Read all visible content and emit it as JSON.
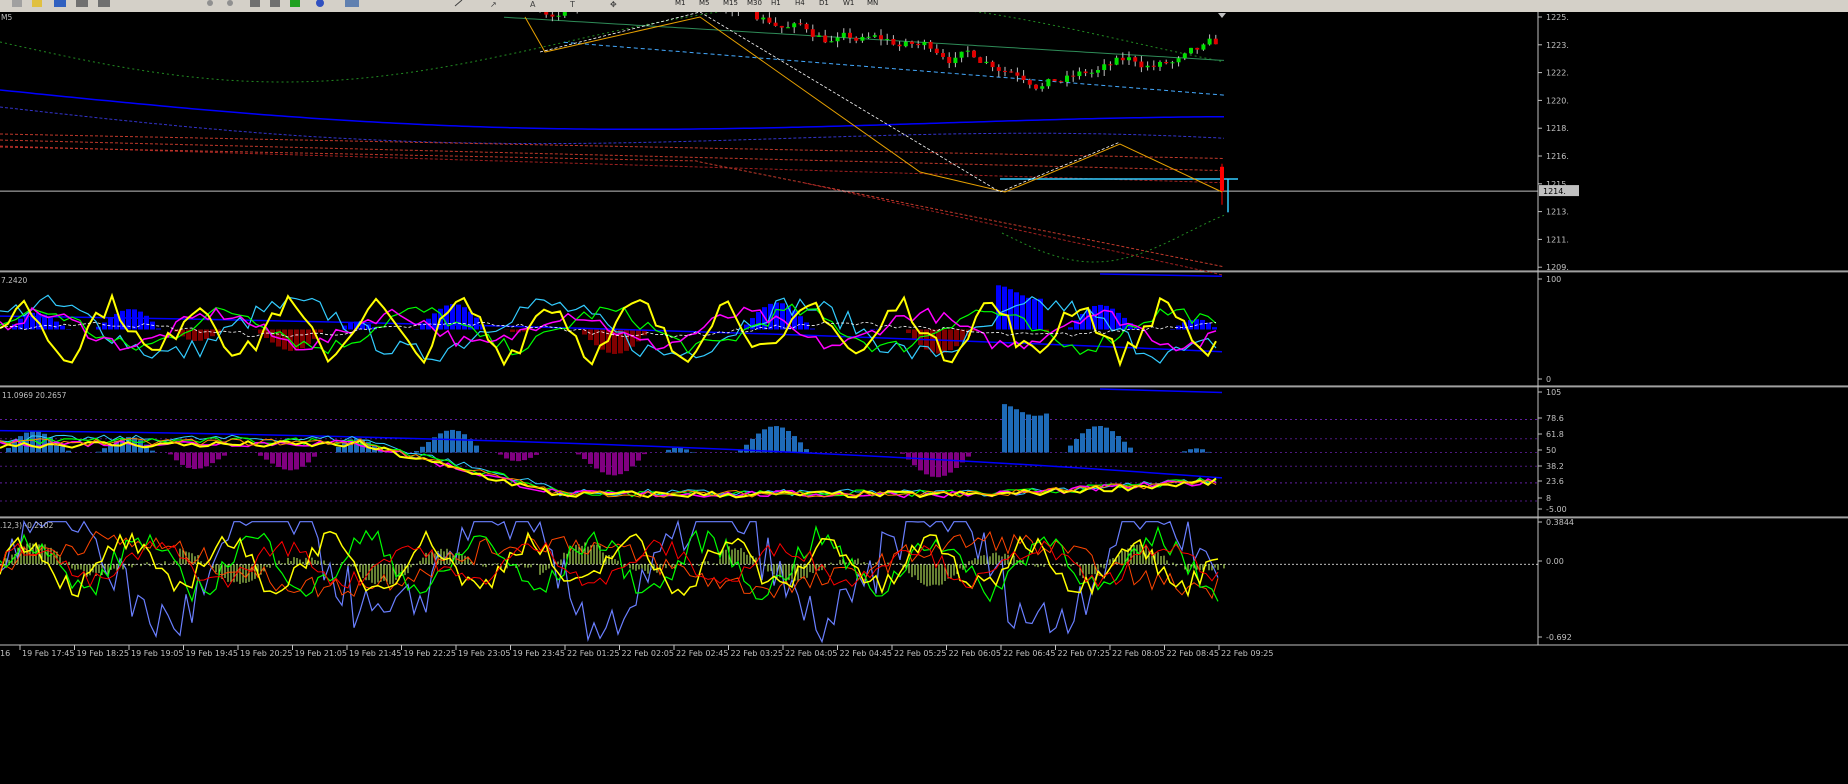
{
  "toolbar": {
    "timeframes": [
      "M1",
      "M5",
      "M15",
      "M30",
      "H1",
      "H4",
      "D1",
      "W1",
      "MN"
    ]
  },
  "chart_data": [
    {
      "type": "candlestick",
      "header": "M5",
      "price_axis_ticks": [
        "1225.",
        "1223.",
        "1222.",
        "1220.",
        "1218.",
        "1216.",
        "1215.",
        "1213.",
        "1211.",
        "1209."
      ],
      "current_price": "1214.",
      "ylim": [
        1209,
        1226
      ]
    },
    {
      "type": "oscillator",
      "header": "7.2420",
      "axis_ticks": [
        "100",
        "0"
      ],
      "ylim": [
        0,
        100
      ]
    },
    {
      "type": "oscillator",
      "header": "11.0969 20.2657",
      "axis_ticks": [
        "105",
        "78.6",
        "61.8",
        "50",
        "38.2",
        "23.6",
        "8",
        "-5.00"
      ],
      "levels": [
        78.6,
        61.8,
        50,
        38.2,
        23.6,
        8
      ],
      "ylim": [
        -5,
        105
      ]
    },
    {
      "type": "oscillator",
      "header": ".12,3) -0.2102",
      "axis_ticks": [
        "0.3844",
        "0.00",
        "-0.692"
      ],
      "ylim": [
        -0.692,
        0.3844
      ]
    }
  ],
  "time_axis": {
    "first": "16",
    "labels": [
      "19 Feb 17:45",
      "19 Feb 18:25",
      "19 Feb 19:05",
      "19 Feb 19:45",
      "19 Feb 20:25",
      "19 Feb 21:05",
      "19 Feb 21:45",
      "19 Feb 22:25",
      "19 Feb 23:05",
      "19 Feb 23:45",
      "22 Feb 01:25",
      "22 Feb 02:05",
      "22 Feb 02:45",
      "22 Feb 03:25",
      "22 Feb 04:05",
      "22 Feb 04:45",
      "22 Feb 05:25",
      "22 Feb 06:05",
      "22 Feb 06:45",
      "22 Feb 07:25",
      "22 Feb 08:05",
      "22 Feb 08:45",
      "22 Feb 09:25"
    ]
  },
  "colors": {
    "background": "#000000",
    "bull": "#00e000",
    "bear": "#e00000",
    "grid": "#c0c0c0",
    "axis_text": "#c0c0c0",
    "blue_hist": "#0000ff",
    "maroon_hist": "#800000",
    "steel_hist": "#1e6bb8",
    "purple_hist": "#800080",
    "yellow": "#ffff00",
    "cyan": "#33ccff",
    "magenta": "#ff00ff",
    "green": "#00ff00"
  }
}
